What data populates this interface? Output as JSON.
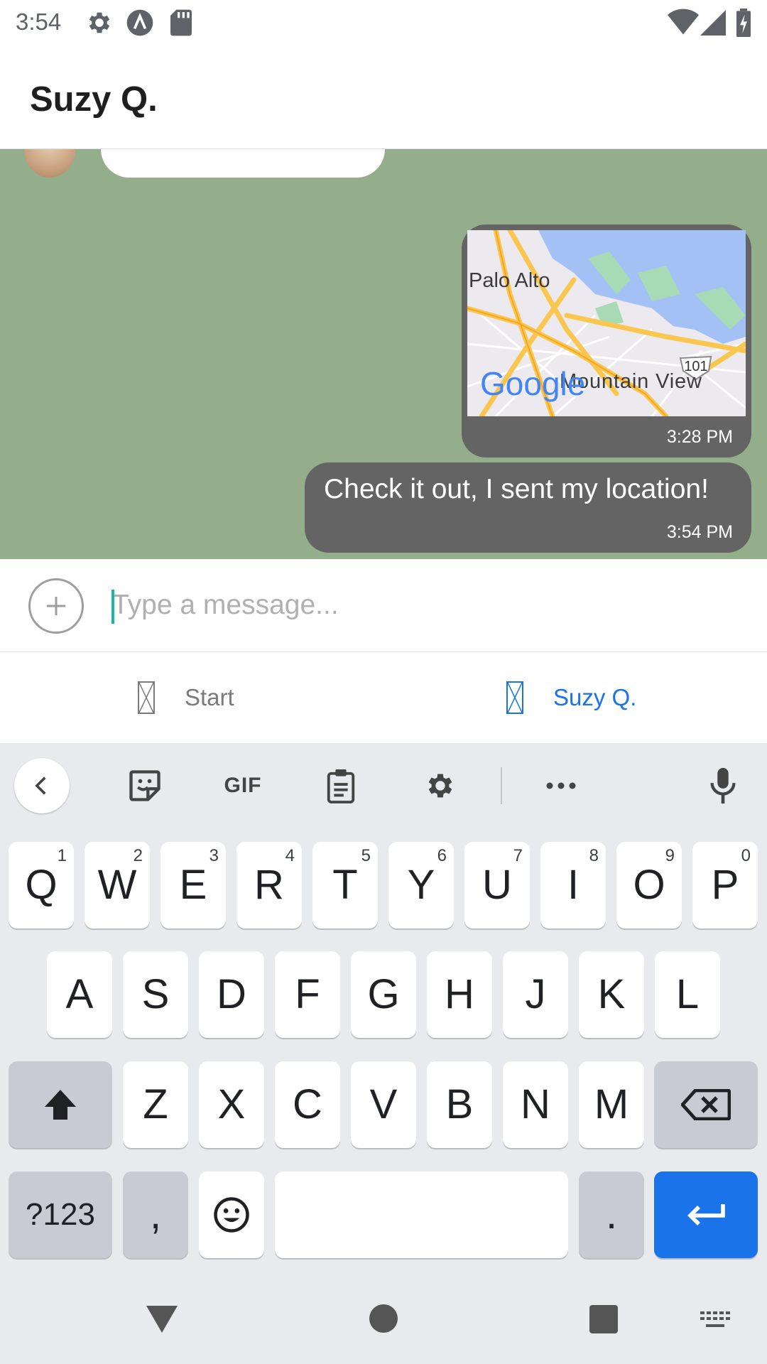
{
  "status_bar": {
    "time": "3:54",
    "icons": [
      "settings-icon",
      "a-icon",
      "sd-card-icon",
      "wifi-icon",
      "signal-icon",
      "battery-icon"
    ]
  },
  "header": {
    "title": "Suzy Q."
  },
  "chat": {
    "messages": [
      {
        "type": "location",
        "map_labels": {
          "city1": "Palo Alto",
          "city2": "Mountain View",
          "highway": "101",
          "logo": "Google"
        },
        "time": "3:28 PM"
      },
      {
        "type": "text",
        "text": "Check it out, I sent my location!",
        "time": "3:54 PM"
      }
    ],
    "background_color": "#94ad8a",
    "bubble_color": "#646464"
  },
  "composer": {
    "placeholder": "Type a message..."
  },
  "tabs": [
    {
      "label": "Start",
      "active": false
    },
    {
      "label": "Suzy Q.",
      "active": true
    }
  ],
  "keyboard": {
    "toolbar": {
      "gif_label": "GIF"
    },
    "row1": [
      {
        "key": "Q",
        "hint": "1"
      },
      {
        "key": "W",
        "hint": "2"
      },
      {
        "key": "E",
        "hint": "3"
      },
      {
        "key": "R",
        "hint": "4"
      },
      {
        "key": "T",
        "hint": "5"
      },
      {
        "key": "Y",
        "hint": "6"
      },
      {
        "key": "U",
        "hint": "7"
      },
      {
        "key": "I",
        "hint": "8"
      },
      {
        "key": "O",
        "hint": "9"
      },
      {
        "key": "P",
        "hint": "0"
      }
    ],
    "row2": [
      "A",
      "S",
      "D",
      "F",
      "G",
      "H",
      "J",
      "K",
      "L"
    ],
    "row3": [
      "Z",
      "X",
      "C",
      "V",
      "B",
      "N",
      "M"
    ],
    "symbols_label": "?123",
    "comma_label": ",",
    "period_label": "."
  },
  "colors": {
    "accent": "#1a73e8",
    "caret": "#1bb6a6"
  }
}
